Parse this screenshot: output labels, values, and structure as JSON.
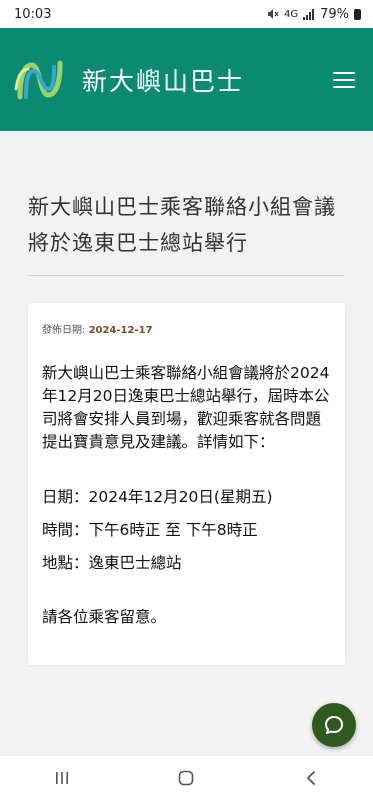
{
  "status_bar": {
    "time": "10:03",
    "network": "4G",
    "battery": "79%"
  },
  "header": {
    "brand": "新大嶼山巴士",
    "logo_icon": "nlb-logo-icon",
    "menu_icon": "hamburger-menu-icon",
    "bg_color": "#0a8a73"
  },
  "article": {
    "title": "新大嶼山巴士乘客聯絡小組會議將於逸東巴士總站舉行",
    "date_label": "發佈日期: ",
    "date_value": "2024-12-17",
    "body": "新大嶼山巴士乘客聯絡小組會議將於2024年12月20日逸東巴士總站舉行，屆時本公司將會安排人員到場，歡迎乘客就各問題提出寶貴意見及建議。詳情如下：",
    "date_line": "日期：2024年12月20日(星期五)",
    "time_line": "時間：下午6時正 至 下午8時正",
    "location_line": "地點：逸東巴士總站",
    "closing": "請各位乘客留意。"
  },
  "chat_button": {
    "icon": "chat-bubble-icon",
    "color": "#2f5a1f"
  },
  "nav_bar": {
    "recents_icon": "recents-icon",
    "home_icon": "home-icon",
    "back_icon": "back-icon"
  }
}
